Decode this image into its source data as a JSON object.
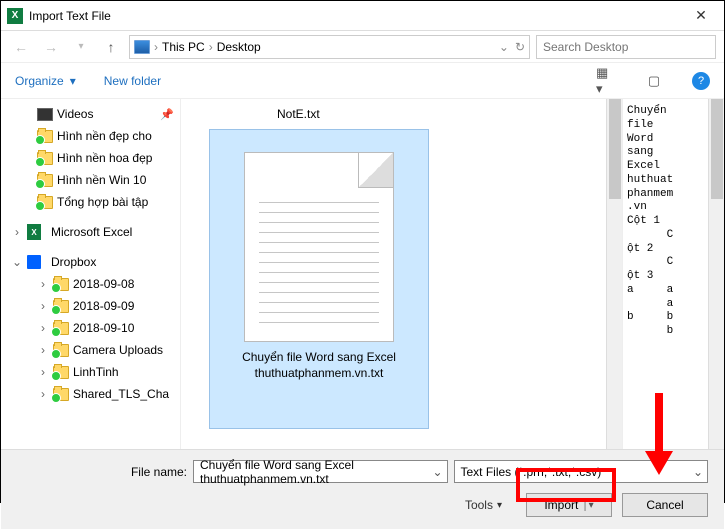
{
  "title": "Import Text File",
  "breadcrumb": {
    "pc": "This PC",
    "location": "Desktop"
  },
  "search_placeholder": "Search Desktop",
  "toolbar": {
    "organize": "Organize",
    "newfolder": "New folder"
  },
  "tree": {
    "videos": "Videos",
    "items": [
      "Hình nền đẹp cho",
      "Hình nền hoa đẹp",
      "Hình nền Win 10",
      "Tổng hợp bài tập"
    ],
    "excel": "Microsoft Excel",
    "dropbox": "Dropbox",
    "dbitems": [
      "2018-09-08",
      "2018-09-09",
      "2018-09-10",
      "Camera Uploads",
      "LinhTinh",
      "Shared_TLS_Cha"
    ]
  },
  "file_top_label": "NotE.txt",
  "selected_label_l1": "Chuyển file Word sang Excel",
  "selected_label_l2": "thuthuatphanmem.vn.txt",
  "preview_text": "Chuyển\nfile\nWord\nsang\nExcel\nhuthuat\nphanmem\n.vn\nCột 1\n      C\nột 2\n      C\nột 3\na     a\n      a\nb     b\n      b",
  "footer": {
    "filename_label": "File name:",
    "filename_value": "Chuyển file Word sang Excel thuthuatphanmem.vn.txt",
    "filter": "Text Files (*.prn;*.txt;*.csv)",
    "tools": "Tools",
    "import": "Import",
    "cancel": "Cancel"
  }
}
